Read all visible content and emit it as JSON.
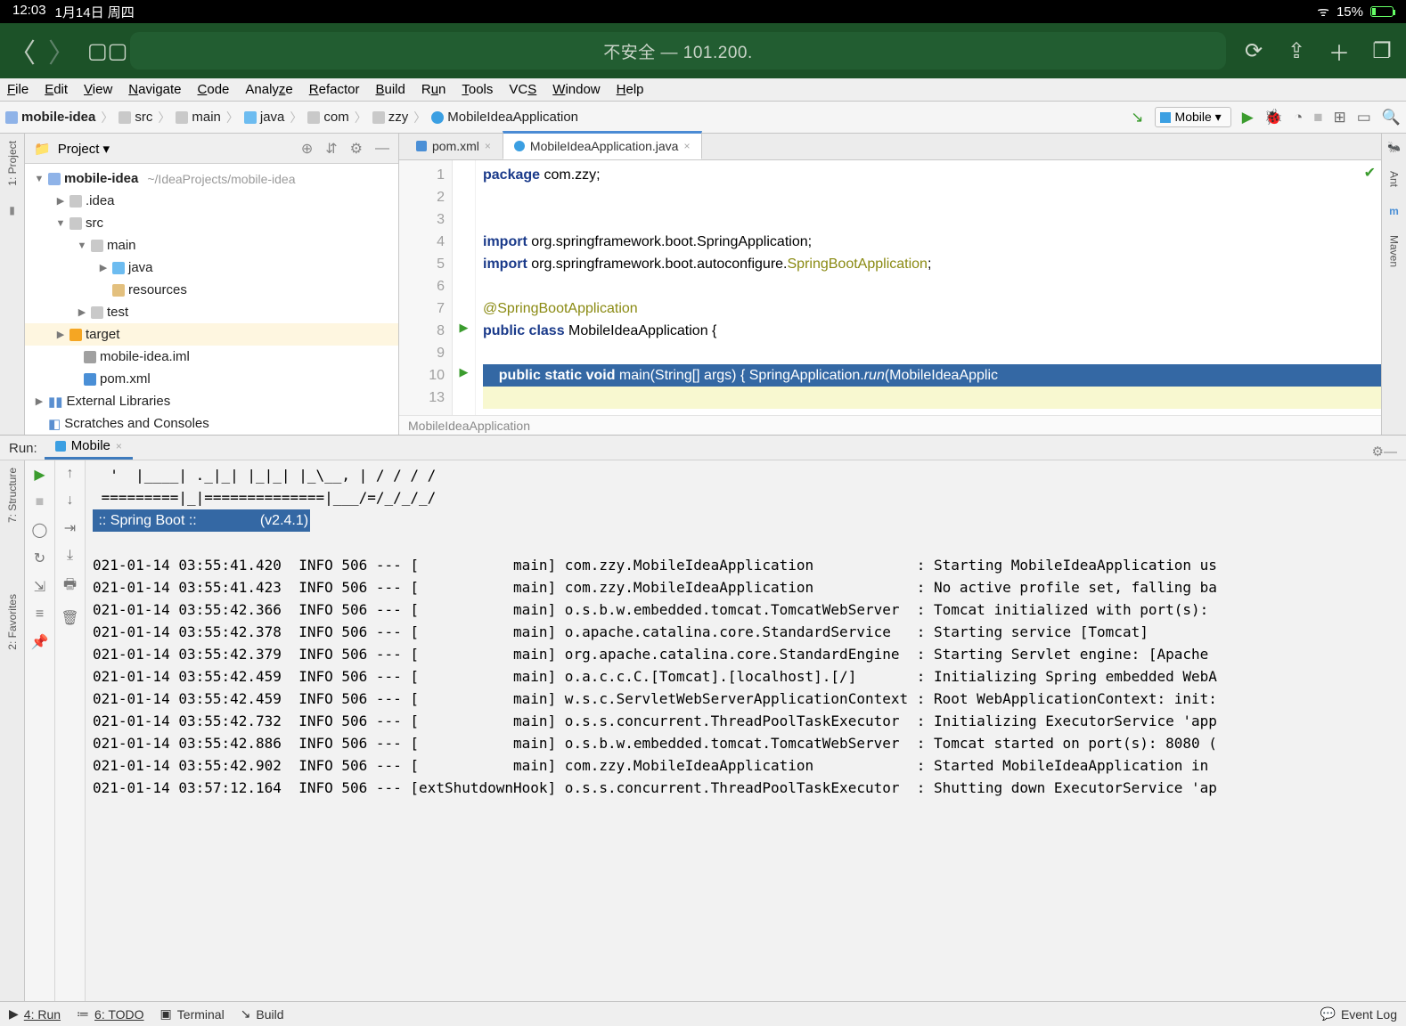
{
  "ipad": {
    "time": "12:03",
    "date": "1月14日 周四",
    "battery": "15%"
  },
  "safari": {
    "url": "不安全 — 101.200."
  },
  "menu": [
    "File",
    "Edit",
    "View",
    "Navigate",
    "Code",
    "Analyze",
    "Refactor",
    "Build",
    "Run",
    "Tools",
    "VCS",
    "Window",
    "Help"
  ],
  "breadcrumb": [
    "mobile-idea",
    "src",
    "main",
    "java",
    "com",
    "zzy",
    "MobileIdeaApplication"
  ],
  "run_config": "Mobile ▾",
  "project_header": "Project ▾",
  "tree": {
    "root": "mobile-idea",
    "root_hint": "~/IdeaProjects/mobile-idea",
    "idea": ".idea",
    "src": "src",
    "main": "main",
    "java": "java",
    "resources": "resources",
    "test": "test",
    "target": "target",
    "iml": "mobile-idea.iml",
    "pom": "pom.xml",
    "ext": "External Libraries",
    "scratch": "Scratches and Consoles"
  },
  "left_tabs": {
    "project": "1: Project",
    "structure": "7: Structure",
    "favorites": "2: Favorites"
  },
  "right_tabs": {
    "ant": "Ant",
    "maven": "Maven"
  },
  "editor_tabs": {
    "pom": "pom.xml",
    "app": "MobileIdeaApplication.java"
  },
  "code": {
    "l1": "package com.zzy;",
    "l4": "import org.springframework.boot.SpringApplication;",
    "l5a": "import org.springframework.boot.autoconfigure.",
    "l5b": "SpringBootApplication",
    "l7": "@SpringBootApplication",
    "l8": "public class MobileIdeaApplication {",
    "l10": "    public static void main(String[] args) { SpringApplication.run(MobileIdeaApplic",
    "crumb": "MobileIdeaApplication"
  },
  "run": {
    "label": "Run:",
    "tab": "Mobile",
    "ascii1": "  '  |____| ._|_| |_|_| |_\\__, | / / / /",
    "ascii2": " =========|_|==============|___/=/_/_/_/",
    "boot": " :: Spring Boot ::                (v2.4.1)",
    "lines": [
      "021-01-14 03:55:41.420  INFO 506 --- [           main] com.zzy.MobileIdeaApplication            : Starting MobileIdeaApplication us",
      "021-01-14 03:55:41.423  INFO 506 --- [           main] com.zzy.MobileIdeaApplication            : No active profile set, falling ba",
      "021-01-14 03:55:42.366  INFO 506 --- [           main] o.s.b.w.embedded.tomcat.TomcatWebServer  : Tomcat initialized with port(s):",
      "021-01-14 03:55:42.378  INFO 506 --- [           main] o.apache.catalina.core.StandardService   : Starting service [Tomcat]",
      "021-01-14 03:55:42.379  INFO 506 --- [           main] org.apache.catalina.core.StandardEngine  : Starting Servlet engine: [Apache",
      "021-01-14 03:55:42.459  INFO 506 --- [           main] o.a.c.c.C.[Tomcat].[localhost].[/]       : Initializing Spring embedded WebA",
      "021-01-14 03:55:42.459  INFO 506 --- [           main] w.s.c.ServletWebServerApplicationContext : Root WebApplicationContext: init:",
      "021-01-14 03:55:42.732  INFO 506 --- [           main] o.s.s.concurrent.ThreadPoolTaskExecutor  : Initializing ExecutorService 'app",
      "021-01-14 03:55:42.886  INFO 506 --- [           main] o.s.b.w.embedded.tomcat.TomcatWebServer  : Tomcat started on port(s): 8080 (",
      "021-01-14 03:55:42.902  INFO 506 --- [           main] com.zzy.MobileIdeaApplication            : Started MobileIdeaApplication in",
      "021-01-14 03:57:12.164  INFO 506 --- [extShutdownHook] o.s.s.concurrent.ThreadPoolTaskExecutor  : Shutting down ExecutorService 'ap"
    ]
  },
  "status": {
    "run": "4: Run",
    "todo": "6: TODO",
    "terminal": "Terminal",
    "build": "Build",
    "event": "Event Log"
  }
}
